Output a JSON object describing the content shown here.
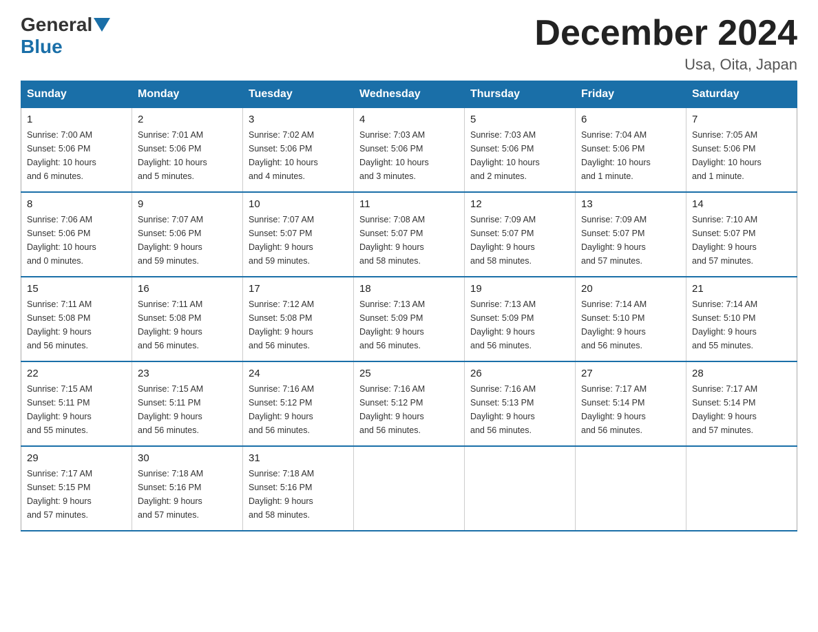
{
  "header": {
    "logo_general": "General",
    "logo_blue": "Blue",
    "month_title": "December 2024",
    "location": "Usa, Oita, Japan"
  },
  "days_of_week": [
    "Sunday",
    "Monday",
    "Tuesday",
    "Wednesday",
    "Thursday",
    "Friday",
    "Saturday"
  ],
  "weeks": [
    [
      {
        "day": "1",
        "info": "Sunrise: 7:00 AM\nSunset: 5:06 PM\nDaylight: 10 hours\nand 6 minutes."
      },
      {
        "day": "2",
        "info": "Sunrise: 7:01 AM\nSunset: 5:06 PM\nDaylight: 10 hours\nand 5 minutes."
      },
      {
        "day": "3",
        "info": "Sunrise: 7:02 AM\nSunset: 5:06 PM\nDaylight: 10 hours\nand 4 minutes."
      },
      {
        "day": "4",
        "info": "Sunrise: 7:03 AM\nSunset: 5:06 PM\nDaylight: 10 hours\nand 3 minutes."
      },
      {
        "day": "5",
        "info": "Sunrise: 7:03 AM\nSunset: 5:06 PM\nDaylight: 10 hours\nand 2 minutes."
      },
      {
        "day": "6",
        "info": "Sunrise: 7:04 AM\nSunset: 5:06 PM\nDaylight: 10 hours\nand 1 minute."
      },
      {
        "day": "7",
        "info": "Sunrise: 7:05 AM\nSunset: 5:06 PM\nDaylight: 10 hours\nand 1 minute."
      }
    ],
    [
      {
        "day": "8",
        "info": "Sunrise: 7:06 AM\nSunset: 5:06 PM\nDaylight: 10 hours\nand 0 minutes."
      },
      {
        "day": "9",
        "info": "Sunrise: 7:07 AM\nSunset: 5:06 PM\nDaylight: 9 hours\nand 59 minutes."
      },
      {
        "day": "10",
        "info": "Sunrise: 7:07 AM\nSunset: 5:07 PM\nDaylight: 9 hours\nand 59 minutes."
      },
      {
        "day": "11",
        "info": "Sunrise: 7:08 AM\nSunset: 5:07 PM\nDaylight: 9 hours\nand 58 minutes."
      },
      {
        "day": "12",
        "info": "Sunrise: 7:09 AM\nSunset: 5:07 PM\nDaylight: 9 hours\nand 58 minutes."
      },
      {
        "day": "13",
        "info": "Sunrise: 7:09 AM\nSunset: 5:07 PM\nDaylight: 9 hours\nand 57 minutes."
      },
      {
        "day": "14",
        "info": "Sunrise: 7:10 AM\nSunset: 5:07 PM\nDaylight: 9 hours\nand 57 minutes."
      }
    ],
    [
      {
        "day": "15",
        "info": "Sunrise: 7:11 AM\nSunset: 5:08 PM\nDaylight: 9 hours\nand 56 minutes."
      },
      {
        "day": "16",
        "info": "Sunrise: 7:11 AM\nSunset: 5:08 PM\nDaylight: 9 hours\nand 56 minutes."
      },
      {
        "day": "17",
        "info": "Sunrise: 7:12 AM\nSunset: 5:08 PM\nDaylight: 9 hours\nand 56 minutes."
      },
      {
        "day": "18",
        "info": "Sunrise: 7:13 AM\nSunset: 5:09 PM\nDaylight: 9 hours\nand 56 minutes."
      },
      {
        "day": "19",
        "info": "Sunrise: 7:13 AM\nSunset: 5:09 PM\nDaylight: 9 hours\nand 56 minutes."
      },
      {
        "day": "20",
        "info": "Sunrise: 7:14 AM\nSunset: 5:10 PM\nDaylight: 9 hours\nand 56 minutes."
      },
      {
        "day": "21",
        "info": "Sunrise: 7:14 AM\nSunset: 5:10 PM\nDaylight: 9 hours\nand 55 minutes."
      }
    ],
    [
      {
        "day": "22",
        "info": "Sunrise: 7:15 AM\nSunset: 5:11 PM\nDaylight: 9 hours\nand 55 minutes."
      },
      {
        "day": "23",
        "info": "Sunrise: 7:15 AM\nSunset: 5:11 PM\nDaylight: 9 hours\nand 56 minutes."
      },
      {
        "day": "24",
        "info": "Sunrise: 7:16 AM\nSunset: 5:12 PM\nDaylight: 9 hours\nand 56 minutes."
      },
      {
        "day": "25",
        "info": "Sunrise: 7:16 AM\nSunset: 5:12 PM\nDaylight: 9 hours\nand 56 minutes."
      },
      {
        "day": "26",
        "info": "Sunrise: 7:16 AM\nSunset: 5:13 PM\nDaylight: 9 hours\nand 56 minutes."
      },
      {
        "day": "27",
        "info": "Sunrise: 7:17 AM\nSunset: 5:14 PM\nDaylight: 9 hours\nand 56 minutes."
      },
      {
        "day": "28",
        "info": "Sunrise: 7:17 AM\nSunset: 5:14 PM\nDaylight: 9 hours\nand 57 minutes."
      }
    ],
    [
      {
        "day": "29",
        "info": "Sunrise: 7:17 AM\nSunset: 5:15 PM\nDaylight: 9 hours\nand 57 minutes."
      },
      {
        "day": "30",
        "info": "Sunrise: 7:18 AM\nSunset: 5:16 PM\nDaylight: 9 hours\nand 57 minutes."
      },
      {
        "day": "31",
        "info": "Sunrise: 7:18 AM\nSunset: 5:16 PM\nDaylight: 9 hours\nand 58 minutes."
      },
      {
        "day": "",
        "info": ""
      },
      {
        "day": "",
        "info": ""
      },
      {
        "day": "",
        "info": ""
      },
      {
        "day": "",
        "info": ""
      }
    ]
  ]
}
